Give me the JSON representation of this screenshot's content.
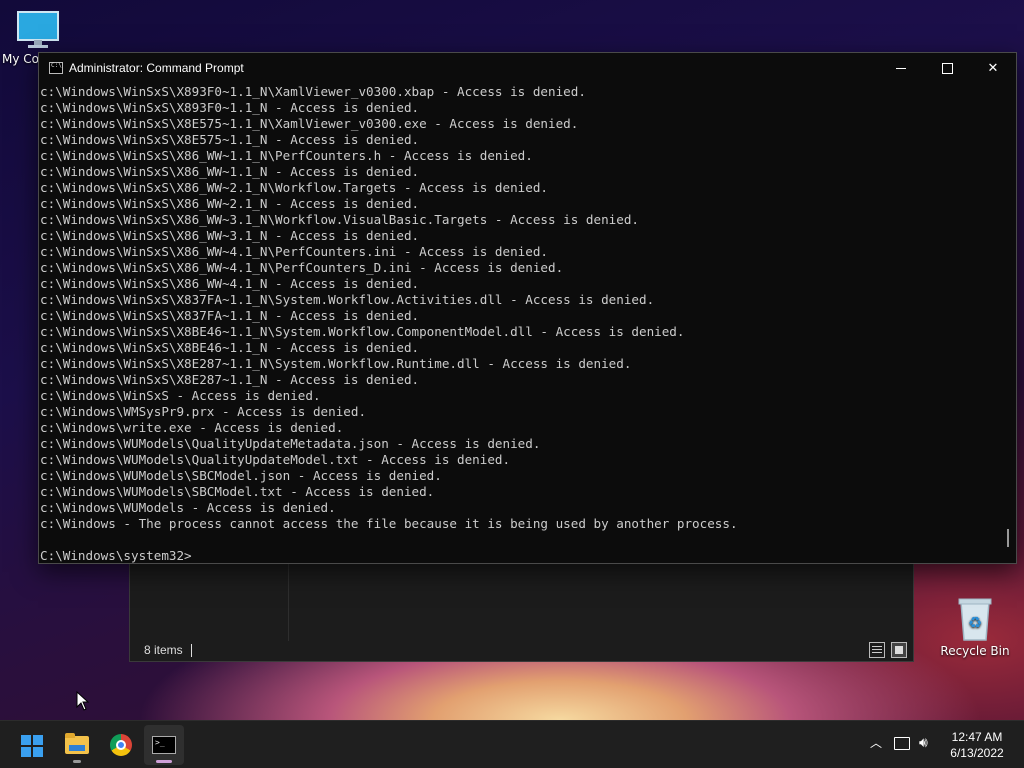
{
  "desktop": {
    "icons": [
      {
        "label": "My Co",
        "icon": "monitor-icon"
      },
      {
        "label": "Recycle Bin",
        "icon": "recycle-bin-icon"
      }
    ]
  },
  "console": {
    "title": "Administrator: Command Prompt",
    "lines": [
      "c:\\Windows\\WinSxS\\X893F0~1.1_N\\XamlViewer_v0300.xbap - Access is denied.",
      "c:\\Windows\\WinSxS\\X893F0~1.1_N - Access is denied.",
      "c:\\Windows\\WinSxS\\X8E575~1.1_N\\XamlViewer_v0300.exe - Access is denied.",
      "c:\\Windows\\WinSxS\\X8E575~1.1_N - Access is denied.",
      "c:\\Windows\\WinSxS\\X86_WW~1.1_N\\PerfCounters.h - Access is denied.",
      "c:\\Windows\\WinSxS\\X86_WW~1.1_N - Access is denied.",
      "c:\\Windows\\WinSxS\\X86_WW~2.1_N\\Workflow.Targets - Access is denied.",
      "c:\\Windows\\WinSxS\\X86_WW~2.1_N - Access is denied.",
      "c:\\Windows\\WinSxS\\X86_WW~3.1_N\\Workflow.VisualBasic.Targets - Access is denied.",
      "c:\\Windows\\WinSxS\\X86_WW~3.1_N - Access is denied.",
      "c:\\Windows\\WinSxS\\X86_WW~4.1_N\\PerfCounters.ini - Access is denied.",
      "c:\\Windows\\WinSxS\\X86_WW~4.1_N\\PerfCounters_D.ini - Access is denied.",
      "c:\\Windows\\WinSxS\\X86_WW~4.1_N - Access is denied.",
      "c:\\Windows\\WinSxS\\X837FA~1.1_N\\System.Workflow.Activities.dll - Access is denied.",
      "c:\\Windows\\WinSxS\\X837FA~1.1_N - Access is denied.",
      "c:\\Windows\\WinSxS\\X8BE46~1.1_N\\System.Workflow.ComponentModel.dll - Access is denied.",
      "c:\\Windows\\WinSxS\\X8BE46~1.1_N - Access is denied.",
      "c:\\Windows\\WinSxS\\X8E287~1.1_N\\System.Workflow.Runtime.dll - Access is denied.",
      "c:\\Windows\\WinSxS\\X8E287~1.1_N - Access is denied.",
      "c:\\Windows\\WinSxS - Access is denied.",
      "c:\\Windows\\WMSysPr9.prx - Access is denied.",
      "c:\\Windows\\write.exe - Access is denied.",
      "c:\\Windows\\WUModels\\QualityUpdateMetadata.json - Access is denied.",
      "c:\\Windows\\WUModels\\QualityUpdateModel.txt - Access is denied.",
      "c:\\Windows\\WUModels\\SBCModel.json - Access is denied.",
      "c:\\Windows\\WUModels\\SBCModel.txt - Access is denied.",
      "c:\\Windows\\WUModels - Access is denied.",
      "c:\\Windows - The process cannot access the file because it is being used by another process.",
      "",
      "C:\\Windows\\system32>"
    ]
  },
  "explorer": {
    "status": "8 items"
  },
  "taskbar": {
    "apps": [
      {
        "name": "start",
        "icon": "windows-start-icon"
      },
      {
        "name": "file-explorer",
        "icon": "folder-icon"
      },
      {
        "name": "chrome",
        "icon": "chrome-icon"
      },
      {
        "name": "command-prompt",
        "icon": "cmd-icon",
        "active": true
      }
    ],
    "clock": {
      "time": "12:47 AM",
      "date": "6/13/2022"
    }
  }
}
